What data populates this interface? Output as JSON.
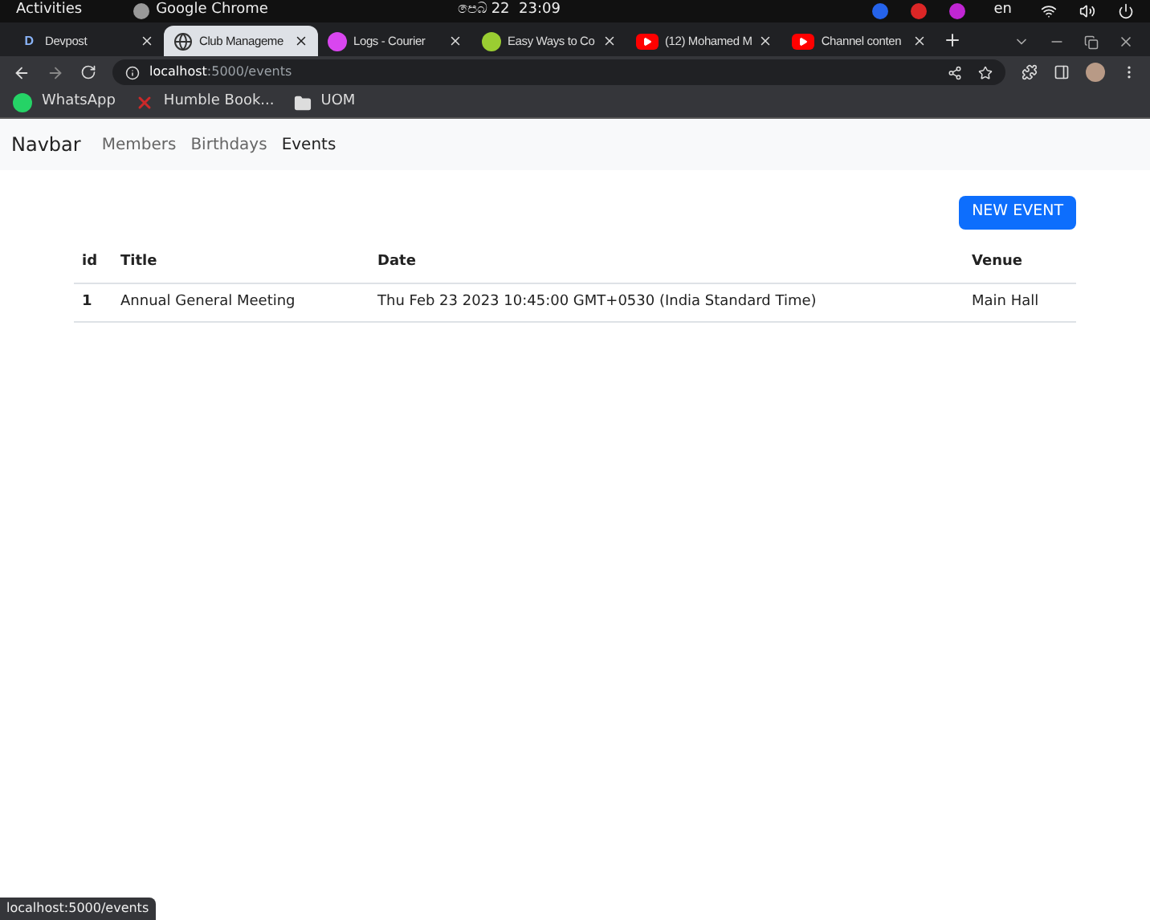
{
  "system_bar": {
    "activities": "Activities",
    "app": "Google Chrome",
    "clock": "පෙබ 22  23:09",
    "language": "en"
  },
  "tabs": [
    {
      "label": "Devpost",
      "selected": false,
      "kind": "letter",
      "badge": "D"
    },
    {
      "label": "Club Manageme",
      "selected": true,
      "kind": "globe"
    },
    {
      "label": "Logs - Courier",
      "selected": false,
      "kind": "courier"
    },
    {
      "label": "Easy Ways to Co",
      "selected": false,
      "kind": "green"
    },
    {
      "label": "(12) Mohamed M",
      "selected": false,
      "kind": "video"
    },
    {
      "label": "Channel conten",
      "selected": false,
      "kind": "video"
    }
  ],
  "address_bar": {
    "host": "localhost",
    "path": ":5000/events"
  },
  "bookmarks": [
    {
      "label": "WhatsApp",
      "kind": "whatsapp"
    },
    {
      "label": "Humble Book...",
      "kind": "humble"
    },
    {
      "label": "UOM",
      "kind": "folder"
    }
  ],
  "navbar": {
    "brand": "Navbar",
    "links": [
      {
        "label": "Members",
        "selected": false
      },
      {
        "label": "Birthdays",
        "selected": false
      },
      {
        "label": "Events",
        "selected": true
      }
    ]
  },
  "new_button": "NEW EVENT",
  "table": {
    "columns": [
      "id",
      "Title",
      "Date",
      "Venue"
    ],
    "rows": [
      [
        "1",
        "Annual General Meeting",
        "Thu Feb 23 2023 10:45:00 GMT+0530 (India Standard Time)",
        "Main Hall"
      ]
    ]
  },
  "status_bar": "localhost:5000/events"
}
